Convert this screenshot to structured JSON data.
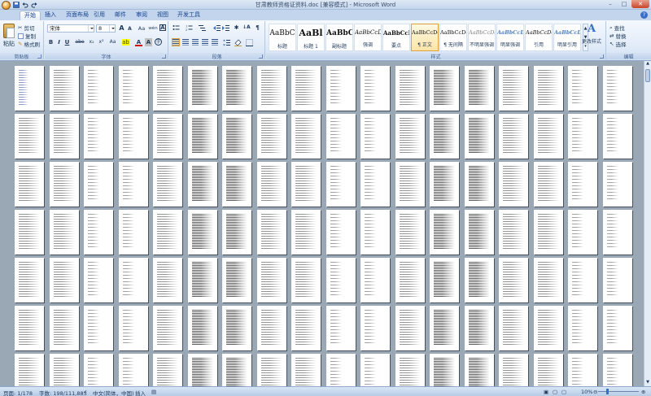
{
  "window": {
    "title": "甘肃教师资格证资料.doc [兼容模式] - Microsoft Word"
  },
  "tabs": [
    "开始",
    "插入",
    "页面布局",
    "引用",
    "邮件",
    "审阅",
    "视图",
    "开发工具"
  ],
  "clipboard": {
    "paste": "粘贴",
    "cut": "剪切",
    "copy": "复制",
    "format_painter": "格式刷",
    "label": "剪贴板"
  },
  "font": {
    "name": "宋体",
    "size": "8",
    "label": "字体",
    "bold": "B",
    "italic": "I",
    "underline": "U",
    "strike": "abe",
    "subscript": "x₂",
    "superscript": "x²",
    "aa": "Aa",
    "grow": "A",
    "shrink": "A",
    "wen": "wén",
    "border_a": "A",
    "font_color": "A",
    "char_shade": "A",
    "enclose": "字"
  },
  "paragraph": {
    "label": "段落"
  },
  "styles": {
    "label": "样式",
    "items": [
      {
        "sample": "AaBbC",
        "name": "标题"
      },
      {
        "sample": "AaBl",
        "name": "标题 1"
      },
      {
        "sample": "AaBbC",
        "name": "副标题"
      },
      {
        "sample": "AaBbCcD",
        "name": "强调"
      },
      {
        "sample": "AaBbCcD",
        "name": "要点"
      },
      {
        "sample": "AaBbCcDc",
        "name": "¶ 正文"
      },
      {
        "sample": "AaBbCcDc",
        "name": "¶ 无间隔"
      },
      {
        "sample": "AaBbCcDc",
        "name": "不明显强调"
      },
      {
        "sample": "AaBbCcDc",
        "name": "明显强调"
      },
      {
        "sample": "AaBbCcDc",
        "name": "引用"
      },
      {
        "sample": "AaBbCcDc",
        "name": "明显引用"
      }
    ],
    "change_styles": "更改样式"
  },
  "editing": {
    "label": "编辑",
    "find": "查找",
    "replace": "替换",
    "select": "选择"
  },
  "status": {
    "page": "页面: 1/178",
    "words": "字数: 198/111,883",
    "language": "中文(简体，中国)",
    "insert": "插入",
    "zoom": "10%"
  }
}
